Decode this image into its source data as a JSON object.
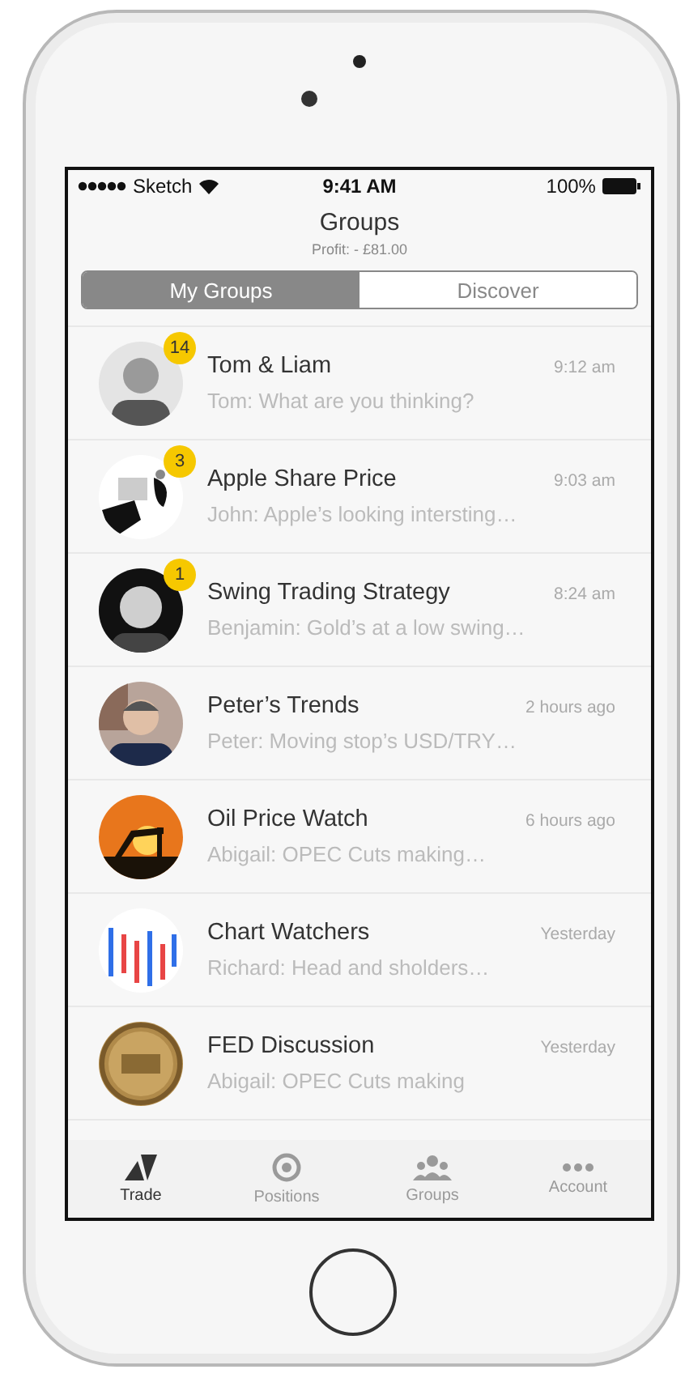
{
  "status_bar": {
    "carrier": "Sketch",
    "time": "9:41 AM",
    "battery": "100%"
  },
  "header": {
    "title": "Groups",
    "subtitle": "Profit: - £81.00"
  },
  "segments": [
    {
      "label": "My Groups",
      "selected": true
    },
    {
      "label": "Discover",
      "selected": false
    }
  ],
  "groups": [
    {
      "name": "Tom & Liam",
      "preview": "Tom: What are you thinking?",
      "time": "9:12 am",
      "unread": "14"
    },
    {
      "name": "Apple Share Price",
      "preview": "John: Apple’s looking intersting…",
      "time": "9:03 am",
      "unread": "3"
    },
    {
      "name": "Swing Trading Strategy",
      "preview": "Benjamin: Gold’s at a low swing…",
      "time": "8:24 am",
      "unread": "1"
    },
    {
      "name": "Peter’s Trends",
      "preview": " Peter: Moving stop’s USD/TRY…",
      "time": "2 hours ago"
    },
    {
      "name": "Oil Price Watch",
      "preview": "Abigail: OPEC Cuts making…",
      "time": "6 hours ago"
    },
    {
      "name": "Chart Watchers",
      "preview": "Richard: Head and sholders…",
      "time": "Yesterday"
    },
    {
      "name": "FED Discussion",
      "preview": "Abigail: OPEC Cuts making",
      "time": "Yesterday"
    }
  ],
  "tab_bar": [
    {
      "label": "Trade",
      "selected": true
    },
    {
      "label": "Positions",
      "selected": false
    },
    {
      "label": "Groups",
      "selected": false
    },
    {
      "label": "Account",
      "selected": false
    }
  ]
}
